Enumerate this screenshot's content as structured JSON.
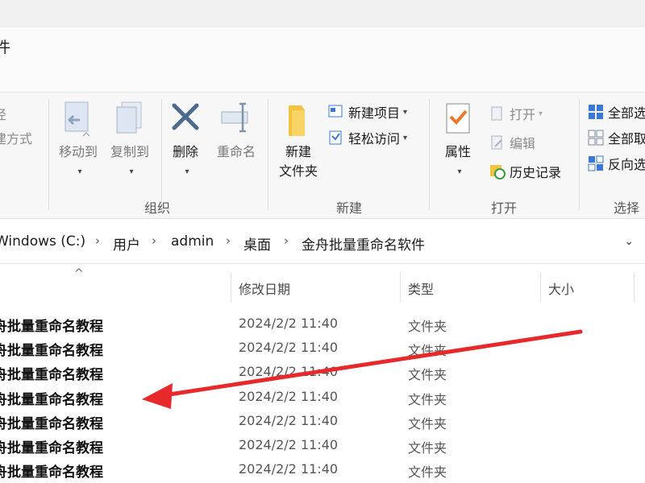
{
  "window": {
    "title_fragment": "件"
  },
  "ribbon": {
    "clipboard_fragments": [
      "径",
      "建方式"
    ],
    "organize": {
      "label": "组织",
      "move_to": "移动到",
      "copy_to": "复制到",
      "delete": "删除",
      "rename": "重命名"
    },
    "new": {
      "label": "新建",
      "new_folder_line1": "新建",
      "new_folder_line2": "文件夹",
      "new_item": "新建项目",
      "easy_access": "轻松访问"
    },
    "open": {
      "label": "打开",
      "properties": "属性",
      "open": "打开",
      "edit": "编辑",
      "history": "历史记录"
    },
    "select": {
      "label": "选择",
      "select_all": "全部选",
      "select_none": "全部取",
      "invert": "反向选"
    }
  },
  "address": {
    "crumbs": [
      "Windows (C:)",
      "用户",
      "admin",
      "桌面",
      "金舟批量重命名软件"
    ]
  },
  "columns": {
    "modified": "修改日期",
    "type": "类型",
    "size": "大小"
  },
  "files": [
    {
      "name": "舟批量重命名教程",
      "date": "2024/2/2 11:40",
      "type": "文件夹"
    },
    {
      "name": "舟批量重命名教程",
      "date": "2024/2/2 11:40",
      "type": "文件夹"
    },
    {
      "name": "舟批量重命名教程",
      "date": "2024/2/2 11:40",
      "type": "文件夹"
    },
    {
      "name": "舟批量重命名教程",
      "date": "2024/2/2 11:40",
      "type": "文件夹"
    },
    {
      "name": "舟批量重命名教程",
      "date": "2024/2/2 11:40",
      "type": "文件夹"
    },
    {
      "name": "舟批量重命名教程",
      "date": "2024/2/2 11:40",
      "type": "文件夹"
    },
    {
      "name": "舟批量重命名教程",
      "date": "2024/2/2 11:40",
      "type": "文件夹"
    }
  ],
  "colors": {
    "accent_blue": "#3a78d4",
    "annotation_arrow": "#e8292b",
    "folder_yellow": "#f3c33f",
    "check_orange": "#e8792b"
  }
}
